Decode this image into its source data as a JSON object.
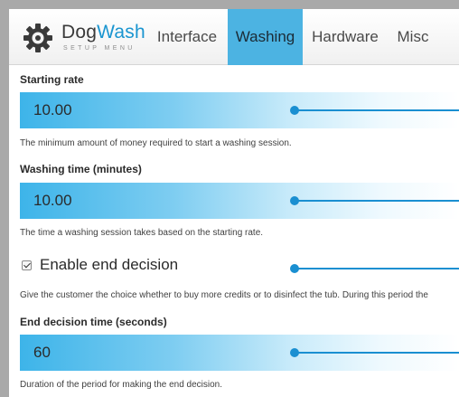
{
  "app": {
    "brand_main": "Dog",
    "brand_accent": "Wash",
    "brand_sub": "SETUP MENU"
  },
  "tabs": [
    {
      "label": "Interface",
      "active": false
    },
    {
      "label": "Washing",
      "active": true
    },
    {
      "label": "Hardware",
      "active": false
    },
    {
      "label": "Misc",
      "active": false
    }
  ],
  "settings": {
    "starting_rate": {
      "label": "Starting rate",
      "value": "10.00",
      "help": "The minimum amount of money required to start a washing session."
    },
    "washing_time": {
      "label": "Washing time (minutes)",
      "value": "10.00",
      "help": "The time a washing session takes based on the starting rate."
    },
    "end_decision": {
      "label": "Enable end decision",
      "checked": true,
      "help": "Give the customer the choice whether to buy more credits or to disinfect the tub. During this period the"
    },
    "end_decision_time": {
      "label": "End decision time (seconds)",
      "value": "60",
      "help": "Duration of the period for making the end decision."
    }
  },
  "colors": {
    "accent": "#1a8fd1",
    "active_tab": "#4cb3e2",
    "field_gradient_start": "#3db4e9"
  }
}
